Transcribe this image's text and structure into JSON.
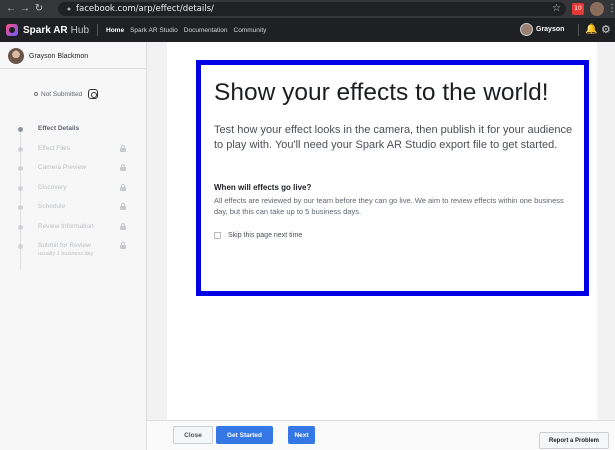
{
  "browser": {
    "url": "facebook.com/arp/effect/details/",
    "extension_badge": "10",
    "icons": [
      "back-icon",
      "forward-icon",
      "refresh-icon",
      "lock-icon",
      "star-icon",
      "menu-dots-icon"
    ]
  },
  "header": {
    "brand": "Spark AR",
    "brand_suffix": "Hub",
    "nav": [
      "Home",
      "Spark AR Studio",
      "Documentation",
      "Community"
    ],
    "user": "Grayson"
  },
  "sidebar": {
    "user_name": "Grayson Blackmon",
    "status": "Not Submitted",
    "steps": [
      {
        "label": "Effect Details",
        "active": true,
        "locked": false
      },
      {
        "label": "Effect Files",
        "active": false,
        "locked": true
      },
      {
        "label": "Camera Preview",
        "active": false,
        "locked": true
      },
      {
        "label": "Discovery",
        "active": false,
        "locked": true
      },
      {
        "label": "Schedule",
        "active": false,
        "locked": true
      },
      {
        "label": "Review Information",
        "active": false,
        "locked": true
      },
      {
        "label": "Submit for Review",
        "sub": "usually 1 business day",
        "active": false,
        "locked": true
      }
    ]
  },
  "main": {
    "headline": "Show your effects to the world!",
    "intro": "Test how your effect looks in the camera, then publish it for your audience to play with. You'll need your Spark AR Studio export file to get started.",
    "subheading": "When will effects go live?",
    "body": "All effects are reviewed by our team before they can go live. We aim to review effects within one business day, but this can take up to 5 business days.",
    "skip_label": "Skip this page next time",
    "skip_checked": false
  },
  "footer": {
    "close_label": "Close",
    "start_label": "Get Started",
    "next_label": "Next",
    "report_label": "Report a Problem"
  },
  "colors": {
    "highlight": "#0000e6",
    "primary_button": "#3578e5",
    "header_bg": "#1f2023"
  }
}
